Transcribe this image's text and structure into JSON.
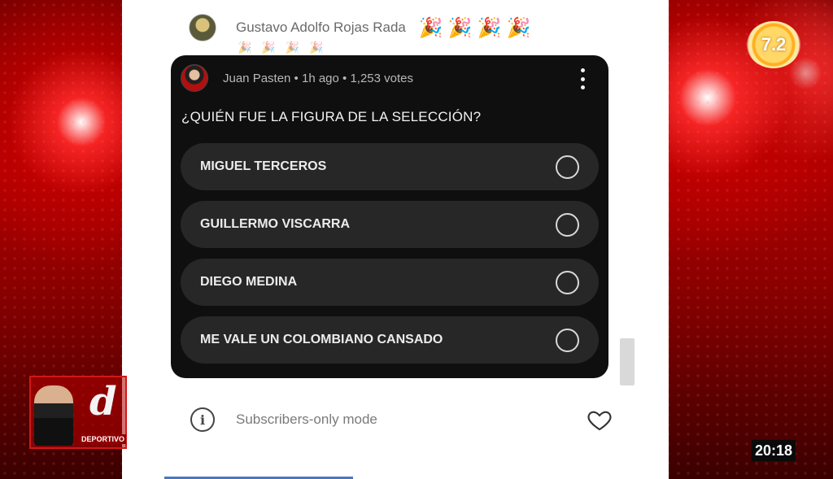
{
  "chat": {
    "author": "Gustavo Adolfo Rojas Rada",
    "emojis": "🎉🎉🎉🎉",
    "emojis_row2": "🎉🎉🎉🎉"
  },
  "poll": {
    "meta": "Juan Pasten • 1h ago • 1,253 votes",
    "question": "¿QUIÉN FUE LA FIGURA DE LA SELECCIÓN?",
    "options": [
      {
        "label": "MIGUEL TERCEROS"
      },
      {
        "label": "GUILLERMO VISCARRA"
      },
      {
        "label": "DIEGO MEDINA"
      },
      {
        "label": "ME VALE UN COLOMBIANO CANSADO"
      }
    ]
  },
  "footer": {
    "mode_text": "Subscribers-only mode",
    "info_glyph": "i"
  },
  "overlay": {
    "channel_number": "7.2",
    "program_letter": "d",
    "program_word": "DEPORTIVO",
    "clock": "20:18"
  },
  "colors": {
    "poll_bg": "#0f0f0f",
    "option_bg": "#272727",
    "studio_red": "#b00000"
  }
}
